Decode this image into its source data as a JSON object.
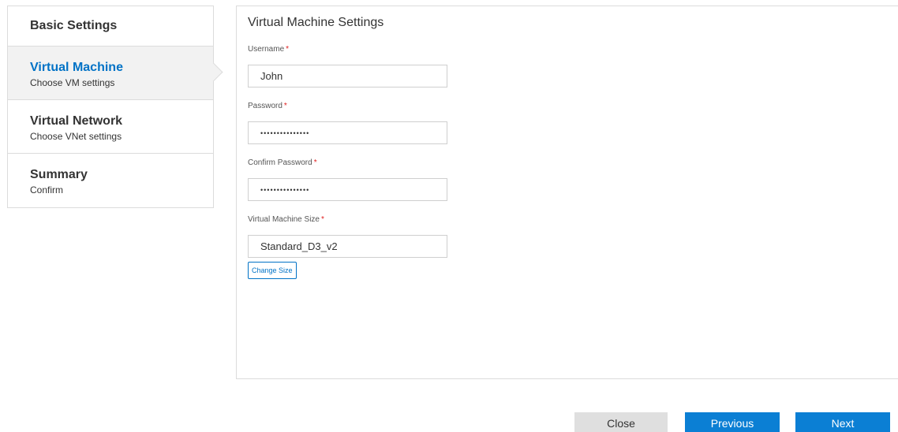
{
  "steps": [
    {
      "title": "Basic Settings",
      "subtitle": ""
    },
    {
      "title": "Virtual Machine",
      "subtitle": "Choose VM settings",
      "active": true
    },
    {
      "title": "Virtual Network",
      "subtitle": "Choose VNet settings"
    },
    {
      "title": "Summary",
      "subtitle": "Confirm"
    }
  ],
  "form": {
    "title": "Virtual Machine Settings",
    "required_marker": "*",
    "username": {
      "label": "Username",
      "value": "John"
    },
    "password": {
      "label": "Password",
      "value": "•••••••••••••••"
    },
    "confirm_password": {
      "label": "Confirm Password",
      "value": "•••••••••••••••"
    },
    "vm_size": {
      "label": "Virtual Machine Size",
      "value": "Standard_D3_v2"
    },
    "change_size_label": "Change Size"
  },
  "footer": {
    "close_label": "Close",
    "previous_label": "Previous",
    "next_label": "Next"
  },
  "colors": {
    "accent": "#0072c6",
    "primary_button": "#0b7fd4",
    "required": "#e02020"
  }
}
